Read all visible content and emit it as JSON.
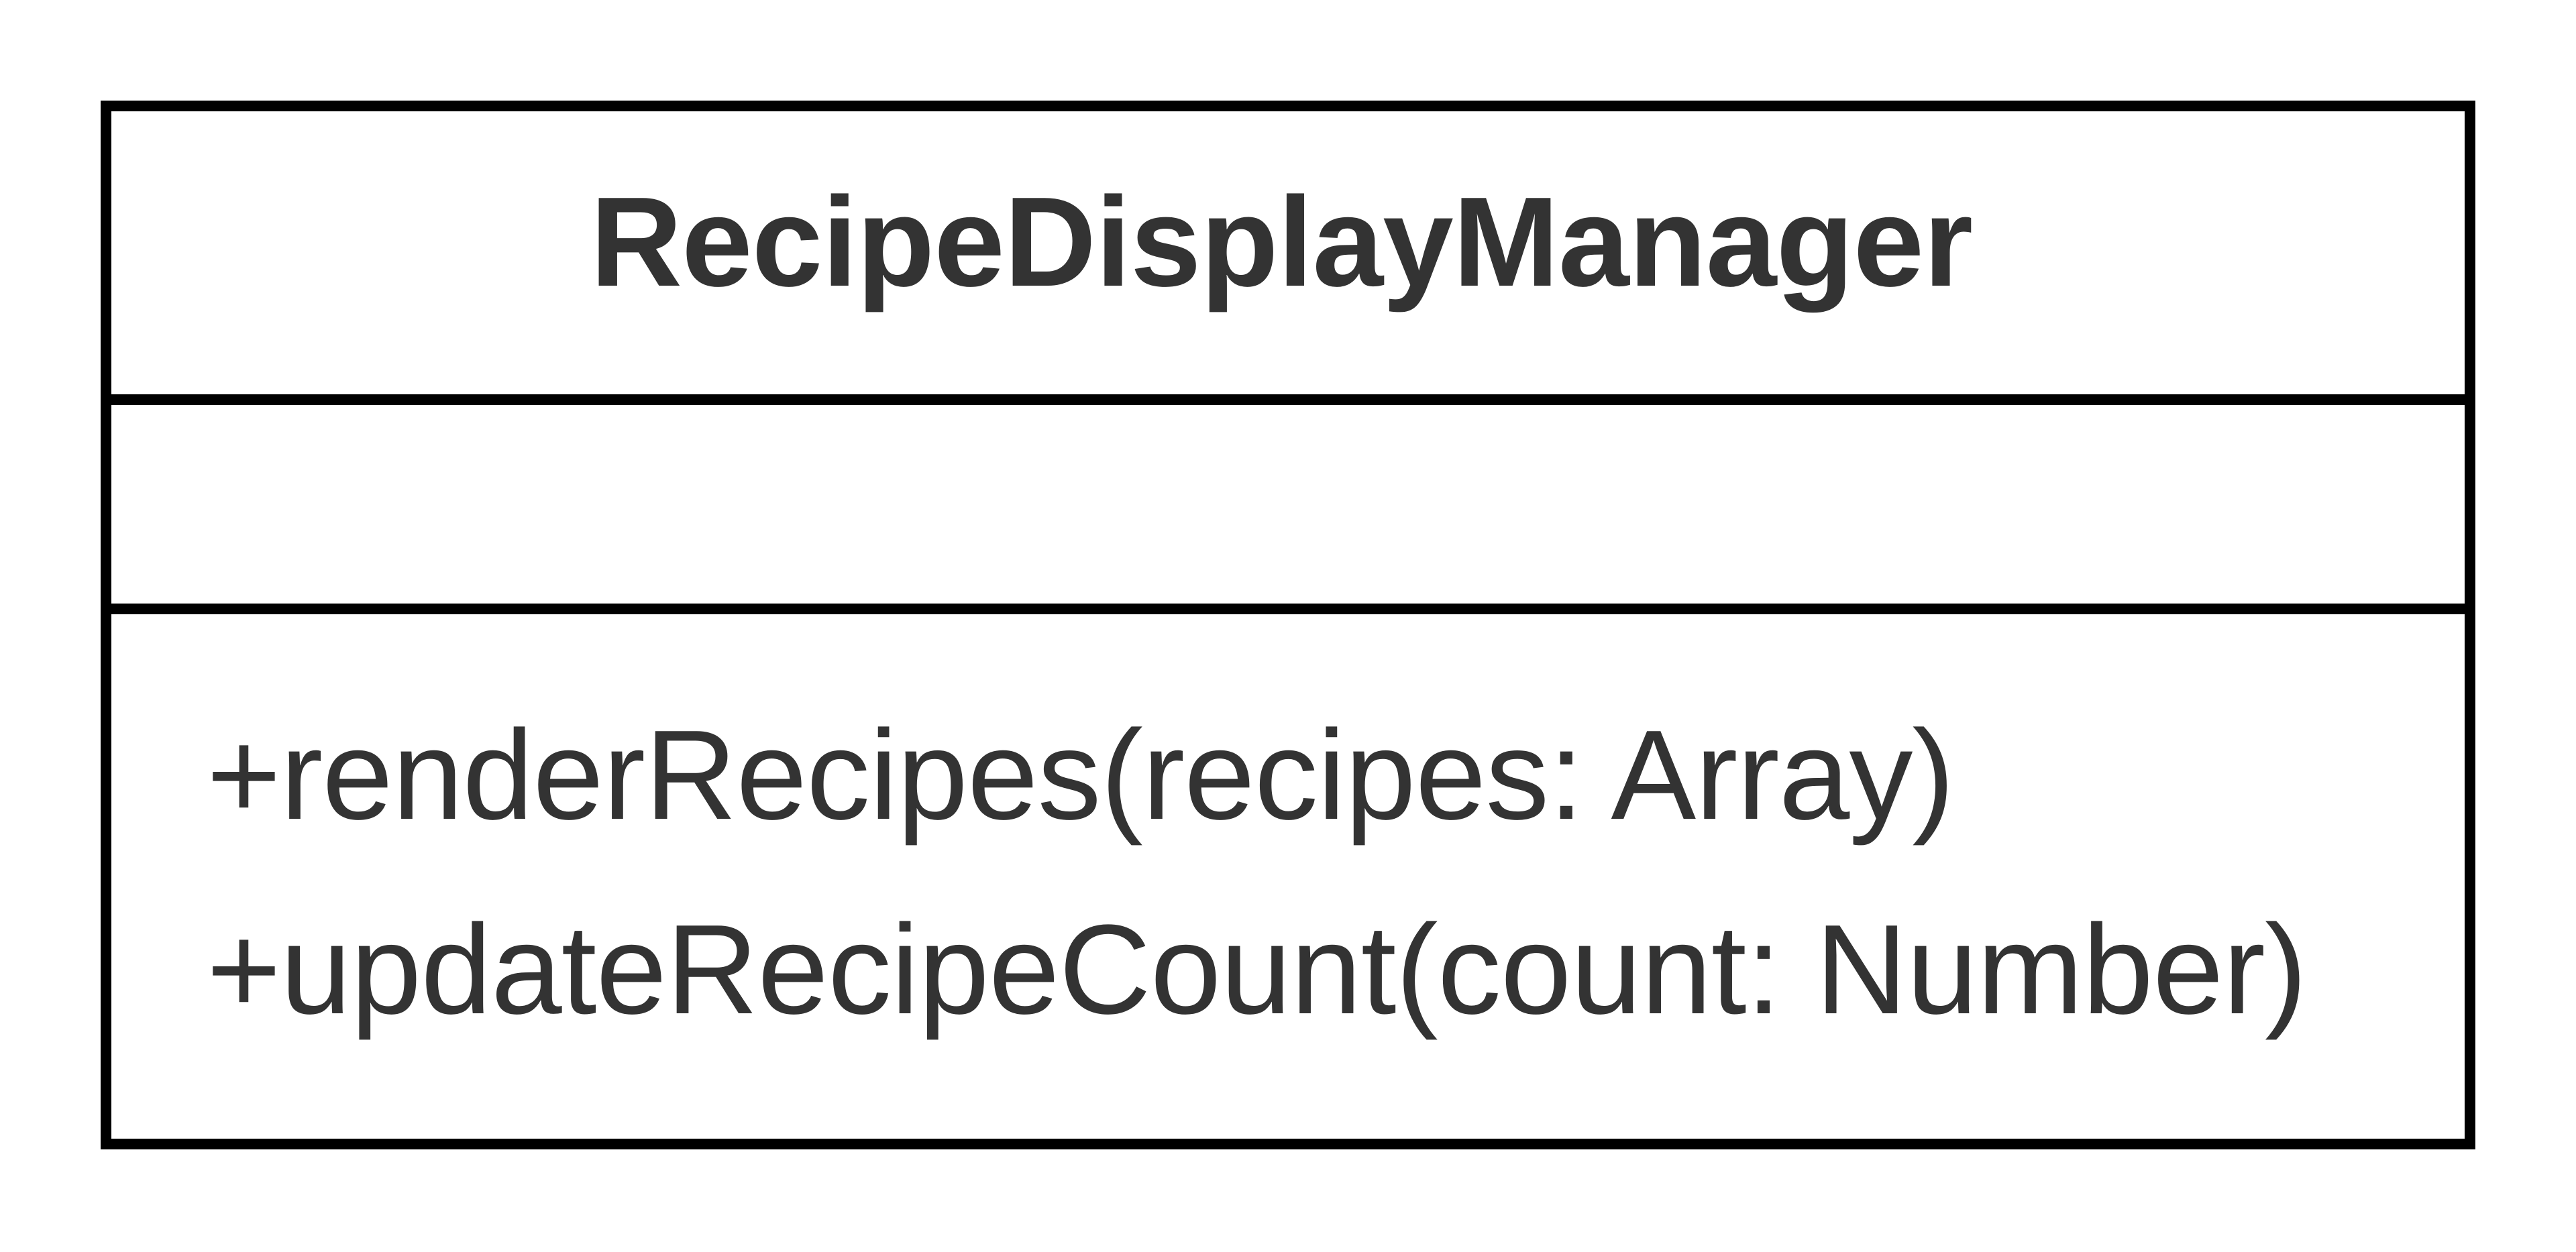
{
  "class": {
    "name": "RecipeDisplayManager",
    "attributes": [],
    "methods": [
      "+renderRecipes(recipes: Array)",
      "+updateRecipeCount(count: Number)"
    ]
  },
  "colors": {
    "border": "#000000",
    "text": "#333333",
    "background": "#ffffff"
  }
}
